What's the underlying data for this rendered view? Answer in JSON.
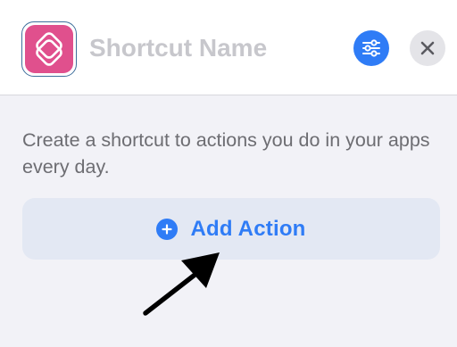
{
  "header": {
    "app_icon": "shortcuts-layers-icon",
    "name_field": {
      "value": "",
      "placeholder": "Shortcut Name"
    },
    "settings_icon": "sliders-icon",
    "close_icon": "close-icon"
  },
  "main": {
    "description": "Create a shortcut to actions you do in your apps every day.",
    "add_action": {
      "label": "Add Action",
      "icon": "plus-circle-icon"
    },
    "annotation": {
      "icon": "pointer-arrow-icon"
    }
  },
  "colors": {
    "accent": "#2f7cf6",
    "app_icon_pink": "#e0508d",
    "description_text": "#6d6d72",
    "add_action_bg": "#e3e8f3",
    "arrow": "#000000"
  }
}
